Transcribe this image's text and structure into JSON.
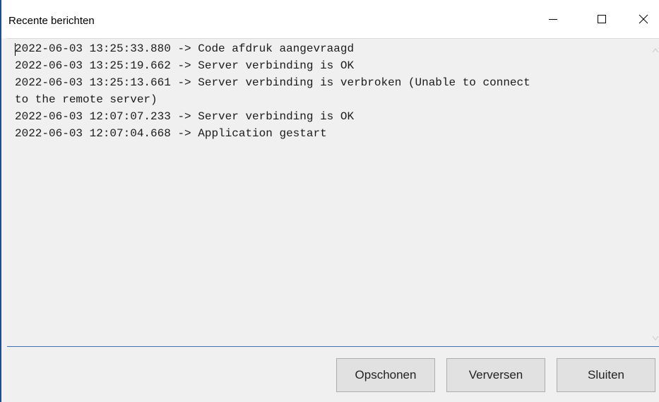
{
  "window": {
    "title": "Recente berichten"
  },
  "titlebar_controls": {
    "minimize_icon": "minimize-icon",
    "maximize_icon": "maximize-icon",
    "close_icon": "close-icon"
  },
  "log": {
    "lines": [
      "2022-06-03 13:25:33.880 -> Code afdruk aangevraagd",
      "2022-06-03 13:25:19.662 -> Server verbinding is OK",
      "2022-06-03 13:25:13.661 -> Server verbinding is verbroken (Unable to connect",
      "to the remote server)",
      "2022-06-03 12:07:07.233 -> Server verbinding is OK",
      "2022-06-03 12:07:04.668 -> Application gestart"
    ]
  },
  "buttons": {
    "opschonen": "Opschonen",
    "verversen": "Verversen",
    "sluiten": "Sluiten"
  },
  "colors": {
    "accent_border": "#3c6fb4",
    "window_background": "#f0f0f0",
    "button_background": "#e1e1e1"
  }
}
